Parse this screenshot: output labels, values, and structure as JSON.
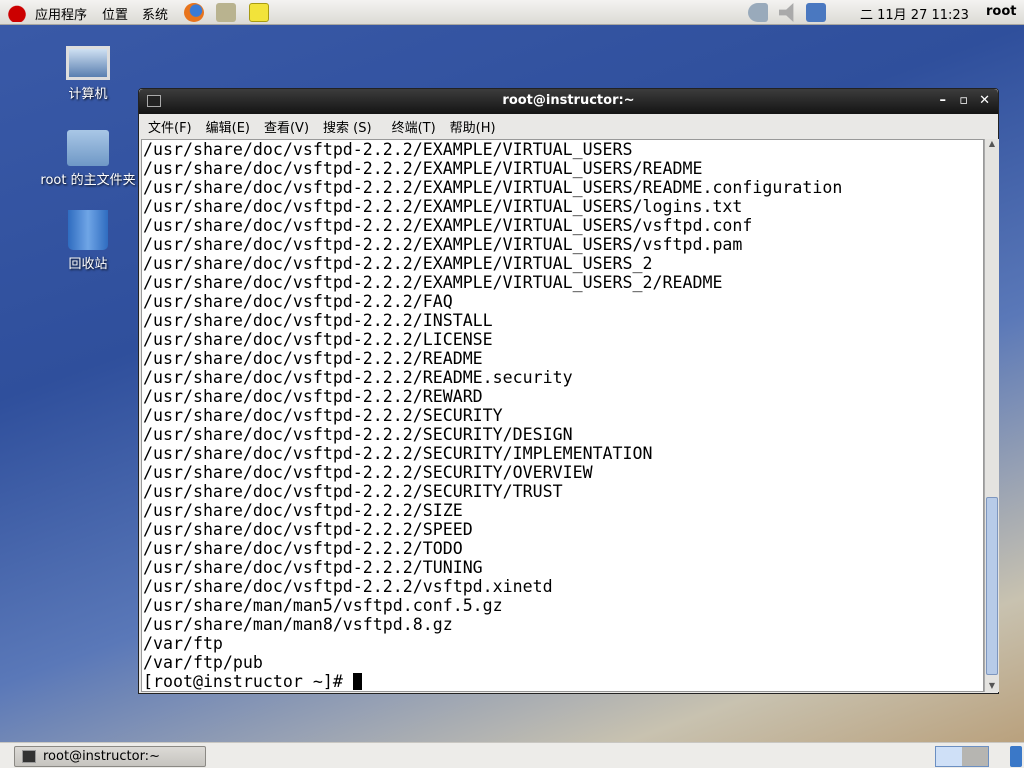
{
  "top_panel": {
    "menus": [
      "应用程序",
      "位置",
      "系统"
    ],
    "clock": "二 11月 27 11:23",
    "user": "root"
  },
  "desktop": {
    "icons": [
      "计算机",
      "root 的主文件夹",
      "回收站"
    ]
  },
  "window": {
    "title": "root@instructor:~",
    "menu": [
      "文件(F)",
      "编辑(E)",
      "查看(V)",
      "搜索 (S)",
      "终端(T)",
      "帮助(H)"
    ],
    "lines": [
      "/usr/share/doc/vsftpd-2.2.2/EXAMPLE/VIRTUAL_USERS",
      "/usr/share/doc/vsftpd-2.2.2/EXAMPLE/VIRTUAL_USERS/README",
      "/usr/share/doc/vsftpd-2.2.2/EXAMPLE/VIRTUAL_USERS/README.configuration",
      "/usr/share/doc/vsftpd-2.2.2/EXAMPLE/VIRTUAL_USERS/logins.txt",
      "/usr/share/doc/vsftpd-2.2.2/EXAMPLE/VIRTUAL_USERS/vsftpd.conf",
      "/usr/share/doc/vsftpd-2.2.2/EXAMPLE/VIRTUAL_USERS/vsftpd.pam",
      "/usr/share/doc/vsftpd-2.2.2/EXAMPLE/VIRTUAL_USERS_2",
      "/usr/share/doc/vsftpd-2.2.2/EXAMPLE/VIRTUAL_USERS_2/README",
      "/usr/share/doc/vsftpd-2.2.2/FAQ",
      "/usr/share/doc/vsftpd-2.2.2/INSTALL",
      "/usr/share/doc/vsftpd-2.2.2/LICENSE",
      "/usr/share/doc/vsftpd-2.2.2/README",
      "/usr/share/doc/vsftpd-2.2.2/README.security",
      "/usr/share/doc/vsftpd-2.2.2/REWARD",
      "/usr/share/doc/vsftpd-2.2.2/SECURITY",
      "/usr/share/doc/vsftpd-2.2.2/SECURITY/DESIGN",
      "/usr/share/doc/vsftpd-2.2.2/SECURITY/IMPLEMENTATION",
      "/usr/share/doc/vsftpd-2.2.2/SECURITY/OVERVIEW",
      "/usr/share/doc/vsftpd-2.2.2/SECURITY/TRUST",
      "/usr/share/doc/vsftpd-2.2.2/SIZE",
      "/usr/share/doc/vsftpd-2.2.2/SPEED",
      "/usr/share/doc/vsftpd-2.2.2/TODO",
      "/usr/share/doc/vsftpd-2.2.2/TUNING",
      "/usr/share/doc/vsftpd-2.2.2/vsftpd.xinetd",
      "/usr/share/man/man5/vsftpd.conf.5.gz",
      "/usr/share/man/man8/vsftpd.8.gz",
      "/var/ftp",
      "/var/ftp/pub"
    ],
    "prompt": "[root@instructor ~]# "
  },
  "taskbar": {
    "task": "root@instructor:~"
  }
}
